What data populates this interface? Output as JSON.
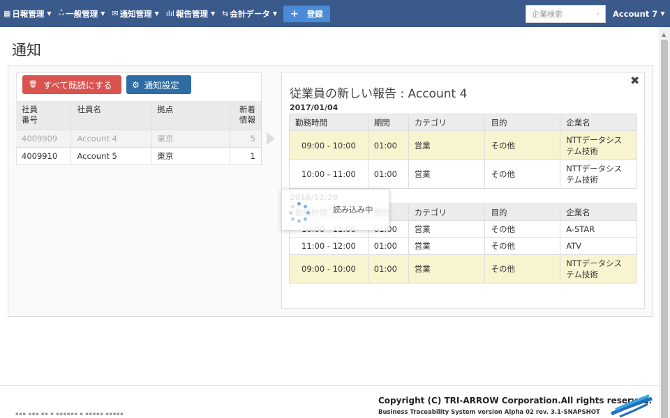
{
  "navbar": {
    "items": [
      {
        "label": "日報管理",
        "icon": "calendar-icon",
        "glyph": "▦"
      },
      {
        "label": "一般管理",
        "icon": "users-icon",
        "glyph": "ஃ"
      },
      {
        "label": "通知管理",
        "icon": "envelope-icon",
        "glyph": "✉"
      },
      {
        "label": "報告管理",
        "icon": "chart-icon",
        "glyph": "ılıl"
      },
      {
        "label": "会計データ",
        "icon": "retweet-icon",
        "glyph": "⇆"
      }
    ],
    "register_label": "登録",
    "search_placeholder": "企業検索",
    "account_label": "Account 7"
  },
  "page": {
    "title": "通知"
  },
  "actions": {
    "mark_all_read": "すべて既読にする",
    "notification_settings": "通知設定"
  },
  "employee_table": {
    "headers": {
      "id": "社員\n番号",
      "name": "社員名",
      "base": "拠点",
      "new": "新着\n情報"
    },
    "rows": [
      {
        "id": "4009909",
        "name": "Account 4",
        "base": "東京",
        "new": "5",
        "disabled": true
      },
      {
        "id": "4009910",
        "name": "Account 5",
        "base": "東京",
        "new": "1",
        "disabled": false
      }
    ]
  },
  "report": {
    "title": "従業員の新しい報告 : Account 4",
    "headers": [
      "勤務時間",
      "期間",
      "カテゴリ",
      "目的",
      "企業名"
    ],
    "groups": [
      {
        "date": "2017/01/04",
        "rows": [
          {
            "time": "09:00 - 10:00",
            "duration": "01:00",
            "category": "営業",
            "purpose": "その他",
            "company": "NTTデータシス\nテム技術",
            "highlight": true
          },
          {
            "time": "10:00 - 11:00",
            "duration": "01:00",
            "category": "営業",
            "purpose": "その他",
            "company": "NTTデータシス\nテム技術",
            "highlight": false
          }
        ]
      },
      {
        "date": "2016/12/29",
        "rows": [
          {
            "time": "10:00 - 11:00",
            "duration": "01:00",
            "category": "営業",
            "purpose": "その他",
            "company": "A-STAR",
            "highlight": false
          },
          {
            "time": "11:00 - 12:00",
            "duration": "01:00",
            "category": "営業",
            "purpose": "その他",
            "company": "ATV",
            "highlight": false
          },
          {
            "time": "09:00 - 10:00",
            "duration": "01:00",
            "category": "営業",
            "purpose": "その他",
            "company": "NTTデータシス\nテム技術",
            "highlight": true
          }
        ]
      }
    ]
  },
  "loading": {
    "text": "読み込み中"
  },
  "footer": {
    "copyright": "Copyright (C) TRI-ARROW Corporation.All rights reserved.",
    "version": "Business Traceability System version Alpha 02 rev. 3.1-SNAPSHOT"
  },
  "colors": {
    "navbar": "#3a5a8c",
    "danger_button": "#d9534f",
    "primary_button": "#2d6ca5",
    "highlight_row": "#f7f4cf"
  }
}
